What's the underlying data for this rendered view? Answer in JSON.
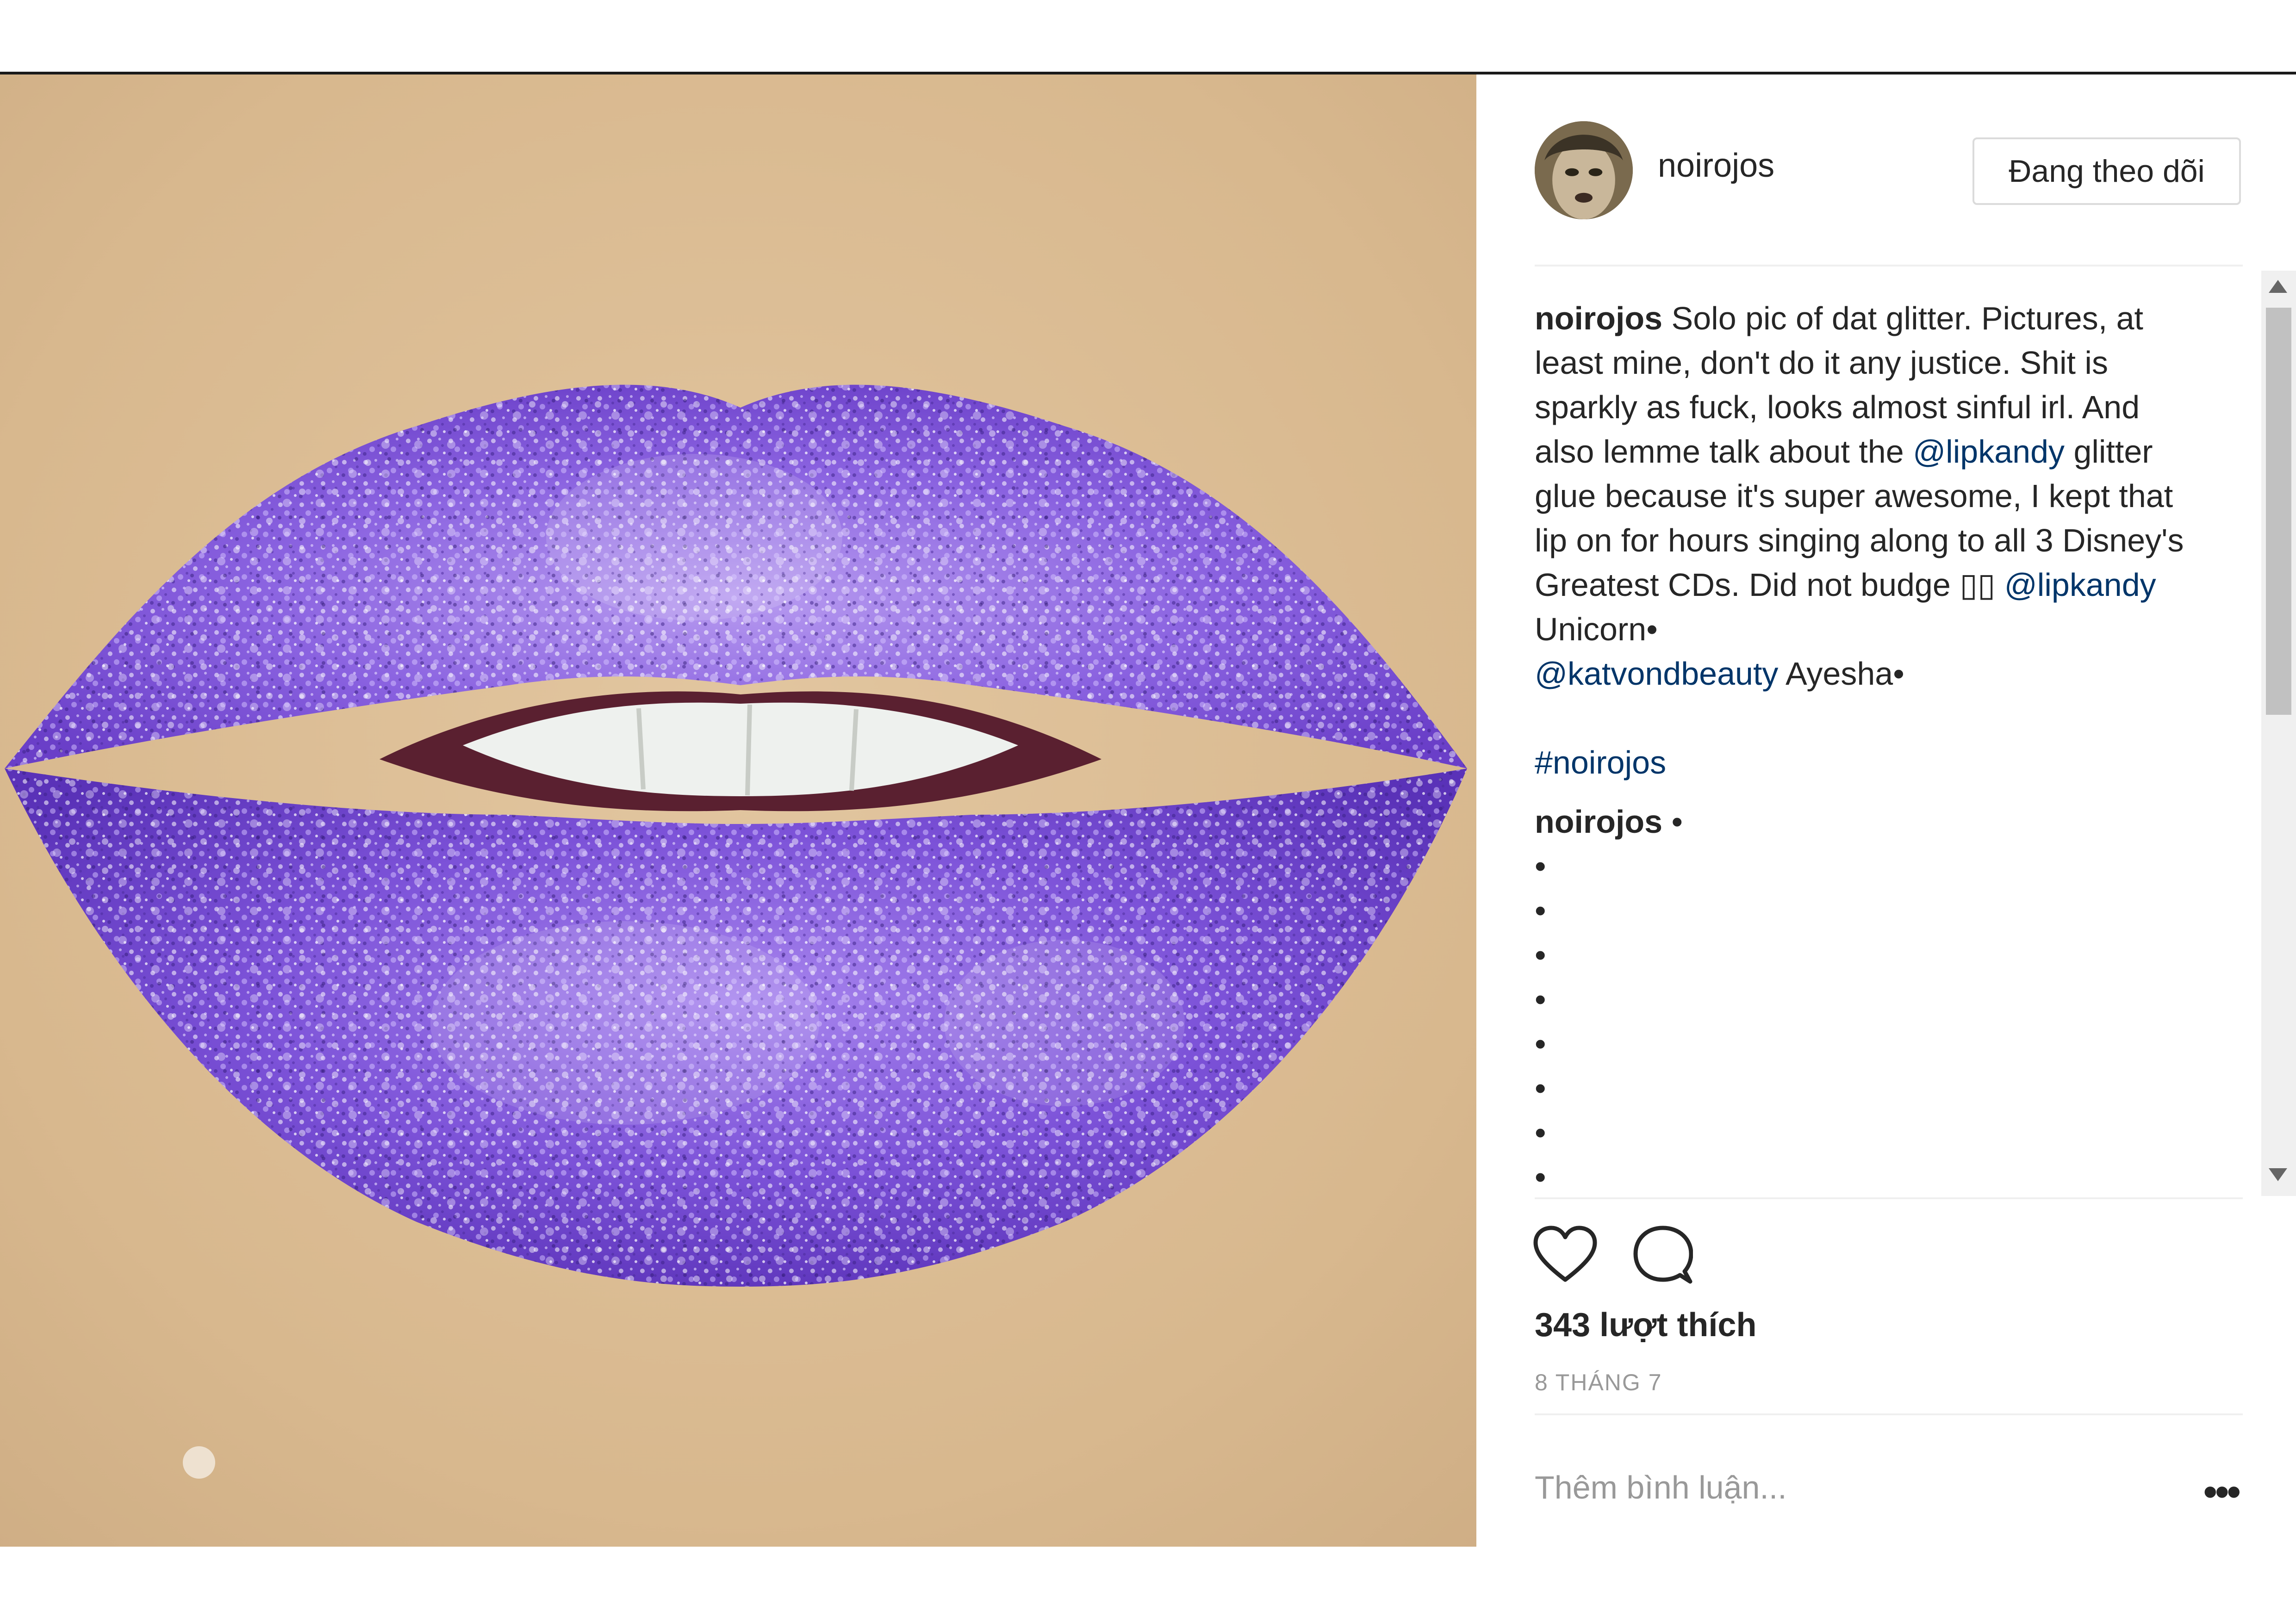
{
  "post": {
    "photo_alt": "purple glitter lips",
    "username": "noirojos",
    "follow_label": "Đang theo dõi",
    "caption": {
      "author": "noirojos",
      "text_1": " Solo pic of dat glitter. Pictures, at least mine, don't do it any justice. Shit is sparkly as fuck, looks almost sinful irl. And also lemme talk about the ",
      "mention_1": "@lipkandy",
      "text_2": " glitter glue because it's super awesome, I kept that lip on for hours singing along to all 3 Disney's Greatest CDs. Did not budge ",
      "emoji": "▯▯",
      "text_3": " ",
      "mention_2": "@lipkandy",
      "text_4": " Unicorn•",
      "mention_3": "@katvondbeauty",
      "text_5": " Ayesha•"
    },
    "hashtag": "#noirojos",
    "comment": {
      "author": "noirojos",
      "text": " •"
    },
    "dots": [
      "•",
      "•",
      "•",
      "•",
      "•",
      "•",
      "•",
      "•"
    ],
    "icons": {
      "like": "heart-icon",
      "comment": "speech-bubble-icon",
      "more": "more-dots-icon"
    },
    "likes": "343 lượt thích",
    "date": "8 THÁNG 7",
    "comment_placeholder": "Thêm bình luận...",
    "more_label": "•••",
    "colors": {
      "link": "#003569",
      "text": "#262626",
      "muted": "#999999",
      "border": "#dbdbdb"
    }
  }
}
